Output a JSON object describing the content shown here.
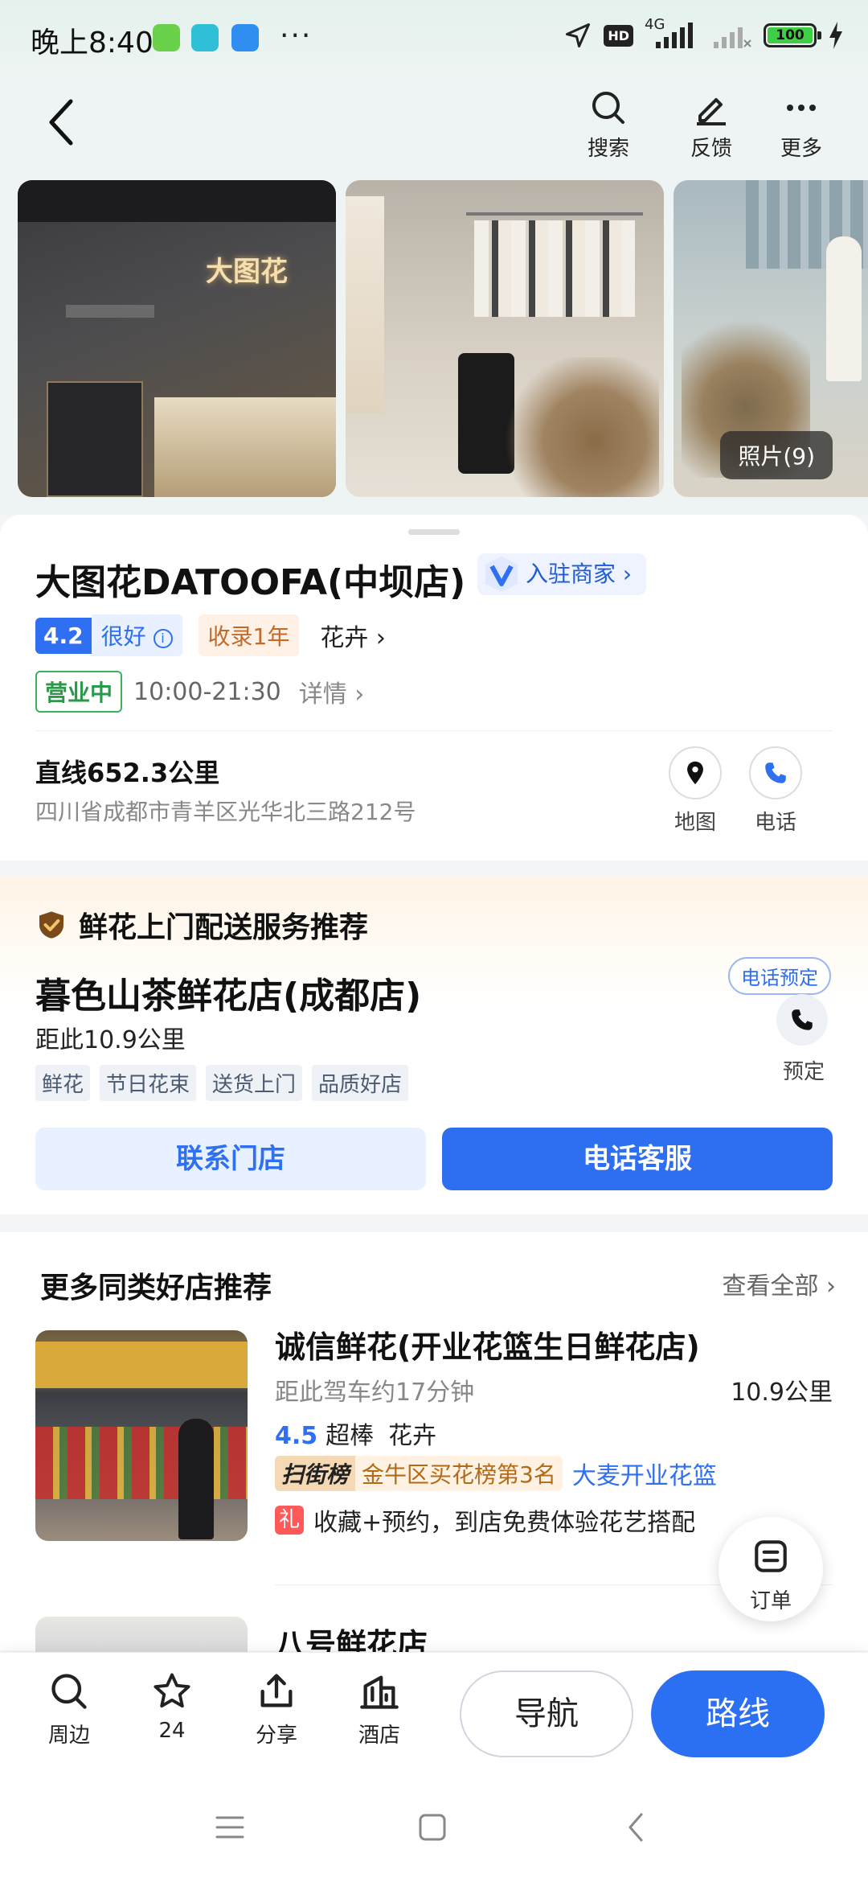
{
  "status_bar": {
    "time": "晚上8:40",
    "dots": "···",
    "hd": "HD",
    "network": "4G",
    "battery": "100"
  },
  "header": {
    "back_label": "",
    "actions": [
      {
        "label": "搜索",
        "icon": "search-icon"
      },
      {
        "label": "反馈",
        "icon": "edit-icon"
      },
      {
        "label": "更多",
        "icon": "more-icon"
      }
    ]
  },
  "photos": {
    "storefront_sign": "大图花",
    "count_label": "照片(9)"
  },
  "shop": {
    "name": "大图花DATOOFA(中坝店)",
    "merchant_badge": "入驻商家",
    "score": "4.2",
    "score_text": "很好",
    "listed_tag": "收录1年",
    "category": "花卉",
    "open_status": "营业中",
    "hours": "10:00-21:30",
    "hours_detail": "详情",
    "distance": "直线652.3公里",
    "address": "四川省成都市青羊区光华北三路212号",
    "map_label": "地图",
    "phone_label": "电话"
  },
  "service": {
    "title": "鲜花上门配送服务推荐",
    "shop_name": "暮色山茶鲜花店(成都店)",
    "distance": "距此10.9公里",
    "tags": [
      "鲜花",
      "节日花束",
      "送货上门",
      "品质好店"
    ],
    "bubble": "电话预定",
    "book_label": "预定",
    "contact_button": "联系门店",
    "phone_button": "电话客服"
  },
  "more": {
    "title": "更多同类好店推荐",
    "see_all": "查看全部",
    "items": [
      {
        "name": "诚信鲜花(开业花篮生日鲜花店)",
        "drive": "距此驾车约17分钟",
        "km": "10.9公里",
        "score": "4.5",
        "score_text": "超棒",
        "category": "花卉",
        "rank_key": "扫街榜",
        "rank_value": "金牛区买花榜第3名",
        "rank_extra": "大麦开业花篮",
        "gift_icon": "礼",
        "gift_text": "收藏+预约，到店免费体验花艺搭配"
      },
      {
        "name": "八号鲜花店"
      }
    ],
    "float_order_label": "订单"
  },
  "bottom_bar": {
    "items": [
      {
        "label": "周边",
        "icon": "search-icon"
      },
      {
        "label": "24",
        "icon": "star-icon"
      },
      {
        "label": "分享",
        "icon": "share-icon"
      },
      {
        "label": "酒店",
        "icon": "hotel-icon"
      }
    ],
    "nav_button": "导航",
    "route_button": "路线"
  },
  "colors": {
    "accent": "#2f6ff2",
    "open_green": "#2a9a4a",
    "rank_orange": "#b36a18"
  }
}
